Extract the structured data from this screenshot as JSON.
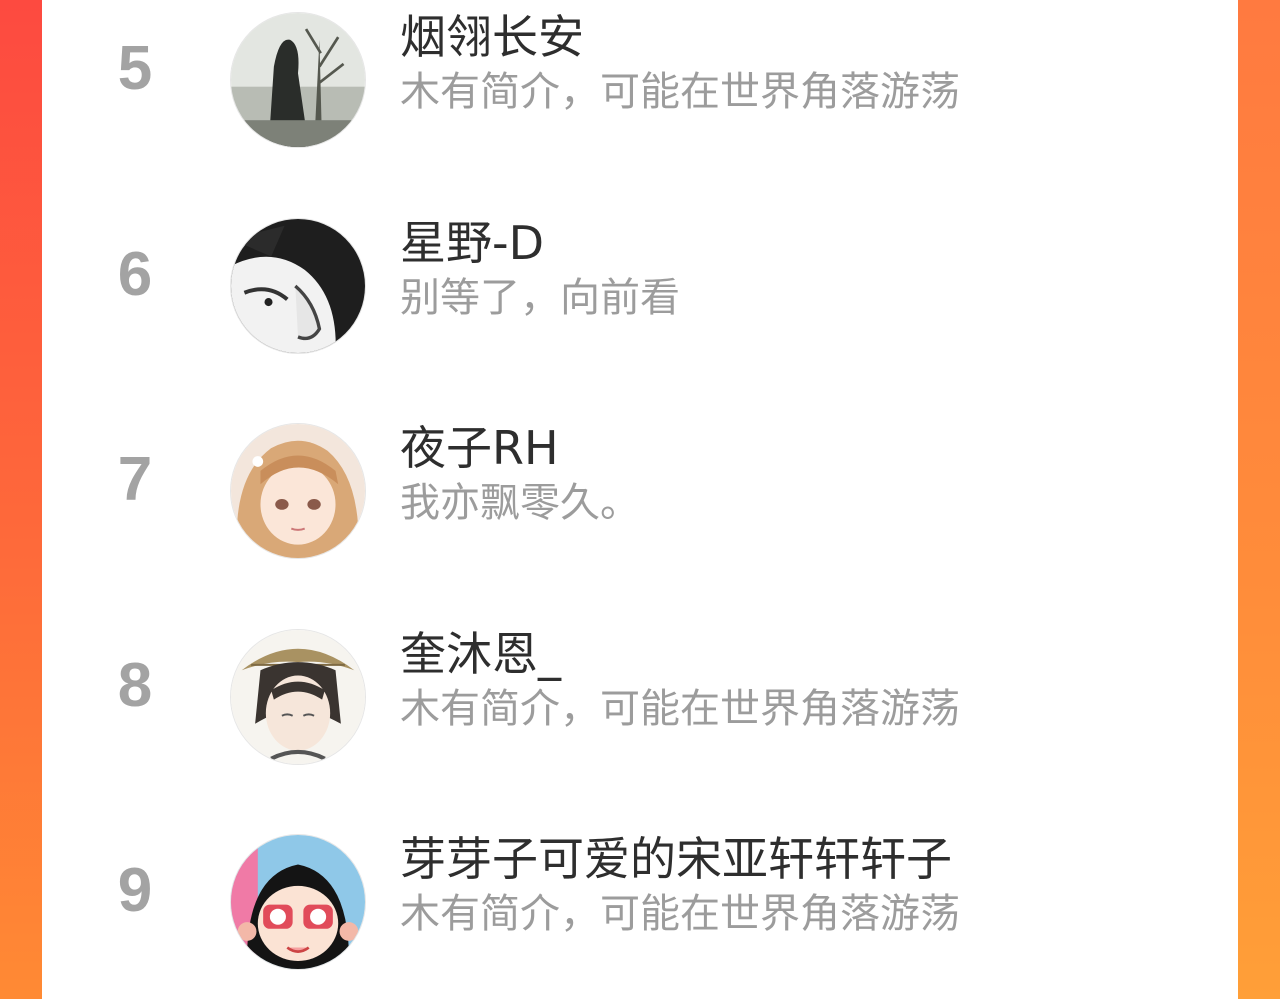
{
  "ranking": {
    "rows": [
      {
        "rank": "5",
        "name": "烟翎长安",
        "bio": "木有简介，可能在世界角落游荡"
      },
      {
        "rank": "6",
        "name": "星野-D",
        "bio": "别等了，向前看"
      },
      {
        "rank": "7",
        "name": "夜子RH",
        "bio": "我亦飘零久。"
      },
      {
        "rank": "8",
        "name": "奎沐恩_",
        "bio": "木有简介，可能在世界角落游荡"
      },
      {
        "rank": "9",
        "name": "芽芽子可爱的宋亚轩轩轩子",
        "bio": "木有简介，可能在世界角落游荡"
      }
    ]
  },
  "colors": {
    "background_gradient_top": "#fd4a40",
    "background_gradient_bottom": "#ff8a34",
    "rank_number": "#a3a3a3",
    "name_text": "#2e2e2e",
    "bio_text": "#9c9c9c"
  }
}
